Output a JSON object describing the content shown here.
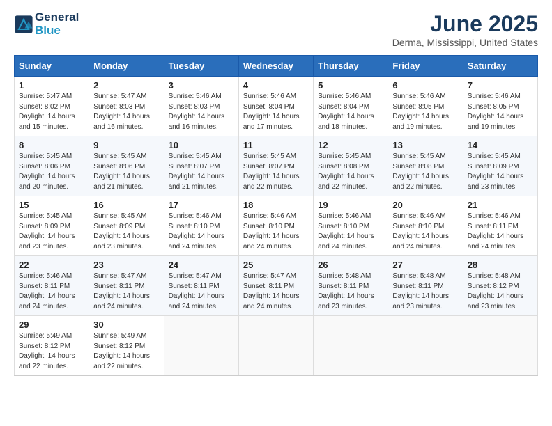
{
  "header": {
    "logo_line1": "General",
    "logo_line2": "Blue",
    "month_year": "June 2025",
    "location": "Derma, Mississippi, United States"
  },
  "days_of_week": [
    "Sunday",
    "Monday",
    "Tuesday",
    "Wednesday",
    "Thursday",
    "Friday",
    "Saturday"
  ],
  "weeks": [
    [
      {
        "day": "1",
        "info": "Sunrise: 5:47 AM\nSunset: 8:02 PM\nDaylight: 14 hours and 15 minutes."
      },
      {
        "day": "2",
        "info": "Sunrise: 5:47 AM\nSunset: 8:03 PM\nDaylight: 14 hours and 16 minutes."
      },
      {
        "day": "3",
        "info": "Sunrise: 5:46 AM\nSunset: 8:03 PM\nDaylight: 14 hours and 16 minutes."
      },
      {
        "day": "4",
        "info": "Sunrise: 5:46 AM\nSunset: 8:04 PM\nDaylight: 14 hours and 17 minutes."
      },
      {
        "day": "5",
        "info": "Sunrise: 5:46 AM\nSunset: 8:04 PM\nDaylight: 14 hours and 18 minutes."
      },
      {
        "day": "6",
        "info": "Sunrise: 5:46 AM\nSunset: 8:05 PM\nDaylight: 14 hours and 19 minutes."
      },
      {
        "day": "7",
        "info": "Sunrise: 5:46 AM\nSunset: 8:05 PM\nDaylight: 14 hours and 19 minutes."
      }
    ],
    [
      {
        "day": "8",
        "info": "Sunrise: 5:45 AM\nSunset: 8:06 PM\nDaylight: 14 hours and 20 minutes."
      },
      {
        "day": "9",
        "info": "Sunrise: 5:45 AM\nSunset: 8:06 PM\nDaylight: 14 hours and 21 minutes."
      },
      {
        "day": "10",
        "info": "Sunrise: 5:45 AM\nSunset: 8:07 PM\nDaylight: 14 hours and 21 minutes."
      },
      {
        "day": "11",
        "info": "Sunrise: 5:45 AM\nSunset: 8:07 PM\nDaylight: 14 hours and 22 minutes."
      },
      {
        "day": "12",
        "info": "Sunrise: 5:45 AM\nSunset: 8:08 PM\nDaylight: 14 hours and 22 minutes."
      },
      {
        "day": "13",
        "info": "Sunrise: 5:45 AM\nSunset: 8:08 PM\nDaylight: 14 hours and 22 minutes."
      },
      {
        "day": "14",
        "info": "Sunrise: 5:45 AM\nSunset: 8:09 PM\nDaylight: 14 hours and 23 minutes."
      }
    ],
    [
      {
        "day": "15",
        "info": "Sunrise: 5:45 AM\nSunset: 8:09 PM\nDaylight: 14 hours and 23 minutes."
      },
      {
        "day": "16",
        "info": "Sunrise: 5:45 AM\nSunset: 8:09 PM\nDaylight: 14 hours and 23 minutes."
      },
      {
        "day": "17",
        "info": "Sunrise: 5:46 AM\nSunset: 8:10 PM\nDaylight: 14 hours and 24 minutes."
      },
      {
        "day": "18",
        "info": "Sunrise: 5:46 AM\nSunset: 8:10 PM\nDaylight: 14 hours and 24 minutes."
      },
      {
        "day": "19",
        "info": "Sunrise: 5:46 AM\nSunset: 8:10 PM\nDaylight: 14 hours and 24 minutes."
      },
      {
        "day": "20",
        "info": "Sunrise: 5:46 AM\nSunset: 8:10 PM\nDaylight: 14 hours and 24 minutes."
      },
      {
        "day": "21",
        "info": "Sunrise: 5:46 AM\nSunset: 8:11 PM\nDaylight: 14 hours and 24 minutes."
      }
    ],
    [
      {
        "day": "22",
        "info": "Sunrise: 5:46 AM\nSunset: 8:11 PM\nDaylight: 14 hours and 24 minutes."
      },
      {
        "day": "23",
        "info": "Sunrise: 5:47 AM\nSunset: 8:11 PM\nDaylight: 14 hours and 24 minutes."
      },
      {
        "day": "24",
        "info": "Sunrise: 5:47 AM\nSunset: 8:11 PM\nDaylight: 14 hours and 24 minutes."
      },
      {
        "day": "25",
        "info": "Sunrise: 5:47 AM\nSunset: 8:11 PM\nDaylight: 14 hours and 24 minutes."
      },
      {
        "day": "26",
        "info": "Sunrise: 5:48 AM\nSunset: 8:11 PM\nDaylight: 14 hours and 23 minutes."
      },
      {
        "day": "27",
        "info": "Sunrise: 5:48 AM\nSunset: 8:11 PM\nDaylight: 14 hours and 23 minutes."
      },
      {
        "day": "28",
        "info": "Sunrise: 5:48 AM\nSunset: 8:12 PM\nDaylight: 14 hours and 23 minutes."
      }
    ],
    [
      {
        "day": "29",
        "info": "Sunrise: 5:49 AM\nSunset: 8:12 PM\nDaylight: 14 hours and 22 minutes."
      },
      {
        "day": "30",
        "info": "Sunrise: 5:49 AM\nSunset: 8:12 PM\nDaylight: 14 hours and 22 minutes."
      },
      {
        "day": "",
        "info": ""
      },
      {
        "day": "",
        "info": ""
      },
      {
        "day": "",
        "info": ""
      },
      {
        "day": "",
        "info": ""
      },
      {
        "day": "",
        "info": ""
      }
    ]
  ]
}
